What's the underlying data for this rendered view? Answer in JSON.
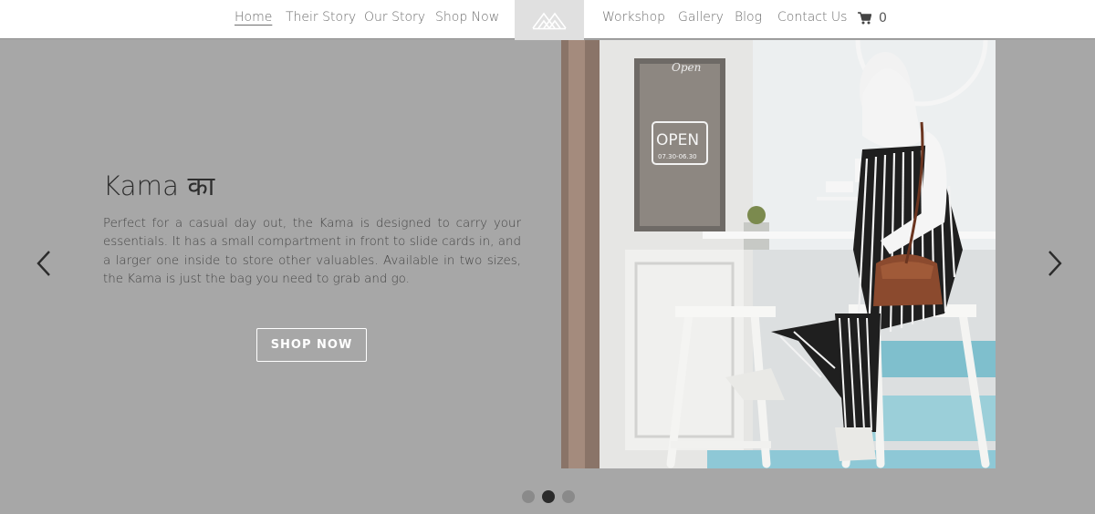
{
  "nav": {
    "left_items": [
      "Home",
      "Their Story",
      "Our Story",
      "Shop Now"
    ],
    "right_items": [
      "Workshop",
      "Gallery",
      "Blog",
      "Contact Us"
    ],
    "active_item": "Home",
    "cart_count": "0",
    "logo_icon": "mountain-logo-icon",
    "cart_icon": "shopping-cart-icon"
  },
  "slide": {
    "title": "Kama का",
    "description": "Perfect for a casual day out, the Kama is designed to carry your essentials. It has a small compartment in front to slide cards in, and a larger one inside to store other valuables. Available in two sizes, the Kama is just the bag you need to grab and go.",
    "cta_label": "SHOP NOW",
    "image_sign_text": "OPEN",
    "image_sign_hours": "07.30-06.30",
    "image_door_text": "Open"
  },
  "carousel": {
    "total_slides": 3,
    "active_index": 1,
    "prev_icon": "chevron-left-icon",
    "next_icon": "chevron-right-icon"
  },
  "colors": {
    "hero_background": "#a7a7a7",
    "nav_background": "#ffffff",
    "logo_background": "#e0e0e0",
    "active_dot": "#2b2b2b",
    "inactive_dot": "#8a8a8a"
  }
}
